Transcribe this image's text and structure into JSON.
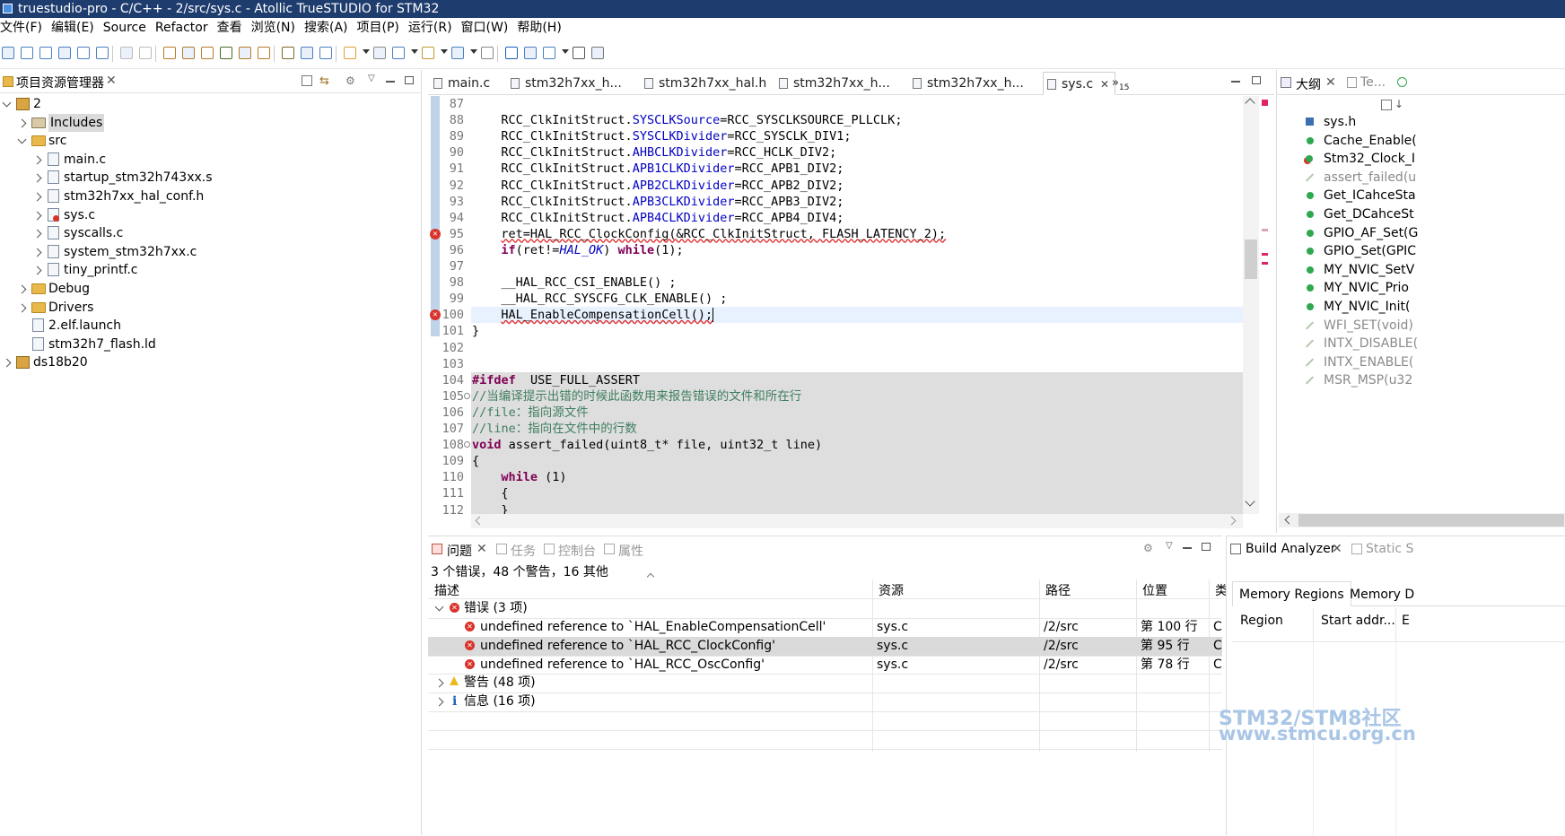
{
  "window": {
    "title": "truestudio-pro - C/C++ - 2/src/sys.c - Atollic TrueSTUDIO for STM32"
  },
  "menu": [
    "文件(F)",
    "编辑(E)",
    "Source",
    "Refactor",
    "查看",
    "浏览(N)",
    "搜索(A)",
    "项目(P)",
    "运行(R)",
    "窗口(W)",
    "帮助(H)"
  ],
  "explorer": {
    "title": "项目资源管理器",
    "tree": [
      {
        "label": "2",
        "depth": 0,
        "icon": "project-icon",
        "expanded": true
      },
      {
        "label": "Includes",
        "depth": 1,
        "icon": "includes-icon",
        "expanded": false,
        "selected": true
      },
      {
        "label": "src",
        "depth": 1,
        "icon": "source-folder-icon",
        "expanded": true
      },
      {
        "label": "main.c",
        "depth": 2,
        "icon": "c-file-icon",
        "expanded": false
      },
      {
        "label": "startup_stm32h743xx.s",
        "depth": 2,
        "icon": "asm-file-icon",
        "expanded": false
      },
      {
        "label": "stm32h7xx_hal_conf.h",
        "depth": 2,
        "icon": "h-file-icon",
        "expanded": false
      },
      {
        "label": "sys.c",
        "depth": 2,
        "icon": "c-file-error-icon",
        "expanded": false
      },
      {
        "label": "syscalls.c",
        "depth": 2,
        "icon": "c-file-icon",
        "expanded": false
      },
      {
        "label": "system_stm32h7xx.c",
        "depth": 2,
        "icon": "c-file-icon",
        "expanded": false
      },
      {
        "label": "tiny_printf.c",
        "depth": 2,
        "icon": "c-file-icon",
        "expanded": false
      },
      {
        "label": "Debug",
        "depth": 1,
        "icon": "folder-icon",
        "expanded": false
      },
      {
        "label": "Drivers",
        "depth": 1,
        "icon": "folder-icon",
        "expanded": false
      },
      {
        "label": "2.elf.launch",
        "depth": 1,
        "icon": "launch-file-icon",
        "leaf": true
      },
      {
        "label": "stm32h7_flash.ld",
        "depth": 1,
        "icon": "ld-file-icon",
        "leaf": true
      },
      {
        "label": "ds18b20",
        "depth": 0,
        "icon": "project-icon",
        "expanded": false
      }
    ]
  },
  "editor": {
    "tabs": [
      {
        "label": "main.c",
        "active": false
      },
      {
        "label": "stm32h7xx_h...",
        "active": false
      },
      {
        "label": "stm32h7xx_hal.h",
        "active": false
      },
      {
        "label": "stm32h7xx_h...",
        "active": false
      },
      {
        "label": "stm32h7xx_h...",
        "active": false
      },
      {
        "label": "sys.c",
        "active": true
      }
    ],
    "overflow_label": "»",
    "overflow_count": "15",
    "lines": [
      {
        "n": "87",
        "t": ""
      },
      {
        "n": "88",
        "t": "RCC_ClkInitStruct.SYSCLKSource=RCC_SYSCLKSOURCE_PLLCLK;"
      },
      {
        "n": "89",
        "t": "RCC_ClkInitStruct.SYSCLKDivider=RCC_SYSCLK_DIV1;"
      },
      {
        "n": "90",
        "t": "RCC_ClkInitStruct.AHBCLKDivider=RCC_HCLK_DIV2;"
      },
      {
        "n": "91",
        "t": "RCC_ClkInitStruct.APB1CLKDivider=RCC_APB1_DIV2;"
      },
      {
        "n": "92",
        "t": "RCC_ClkInitStruct.APB2CLKDivider=RCC_APB2_DIV2;"
      },
      {
        "n": "93",
        "t": "RCC_ClkInitStruct.APB3CLKDivider=RCC_APB3_DIV2;"
      },
      {
        "n": "94",
        "t": "RCC_ClkInitStruct.APB4CLKDivider=RCC_APB4_DIV4;"
      },
      {
        "n": "95",
        "t": "ret=HAL_RCC_ClockConfig(&RCC_ClkInitStruct, FLASH_LATENCY_2);"
      },
      {
        "n": "96",
        "t": "if(ret!=HAL_OK) while(1);"
      },
      {
        "n": "97",
        "t": ""
      },
      {
        "n": "98",
        "t": "__HAL_RCC_CSI_ENABLE() ;"
      },
      {
        "n": "99",
        "t": "__HAL_RCC_SYSCFG_CLK_ENABLE() ;"
      },
      {
        "n": "100",
        "t": "HAL_EnableCompensationCell();"
      },
      {
        "n": "101",
        "t": "}"
      },
      {
        "n": "102",
        "t": ""
      },
      {
        "n": "103",
        "t": ""
      },
      {
        "n": "104",
        "t": "#ifdef  USE_FULL_ASSERT"
      },
      {
        "n": "105",
        "t": "//当编译提示出错的时候此函数用来报告错误的文件和所在行"
      },
      {
        "n": "106",
        "t": "//file：指向源文件"
      },
      {
        "n": "107",
        "t": "//line：指向在文件中的行数"
      },
      {
        "n": "108",
        "t": "void assert_failed(uint8_t* file, uint32_t line)"
      },
      {
        "n": "109",
        "t": "{"
      },
      {
        "n": "110",
        "t": "while (1)"
      },
      {
        "n": "111",
        "t": "{"
      },
      {
        "n": "112",
        "t": "}"
      }
    ]
  },
  "outline": {
    "tab": "大纲",
    "tab2": "Te...",
    "items": [
      "sys.h",
      "Cache_Enable(",
      "Stm32_Clock_I",
      "assert_failed(u",
      "Get_ICahceSta",
      "Get_DCahceSt",
      "GPIO_AF_Set(G",
      "GPIO_Set(GPIC",
      "MY_NVIC_SetV",
      "MY_NVIC_Prio",
      "MY_NVIC_Init(",
      "WFI_SET(void)",
      "INTX_DISABLE(",
      "INTX_ENABLE(",
      "MSR_MSP(u32"
    ]
  },
  "problems": {
    "tabs": [
      "问题",
      "任务",
      "控制台",
      "属性"
    ],
    "summary": "3 个错误，48 个警告，16 其他",
    "columns": [
      "描述",
      "资源",
      "路径",
      "位置",
      "类"
    ],
    "groups": {
      "errors": "错误 (3 项)",
      "warnings": "警告 (48 项)",
      "infos": "信息 (16 项)"
    },
    "rows": [
      {
        "desc": "undefined reference to `HAL_EnableCompensationCell'",
        "res": "sys.c",
        "path": "/2/src",
        "loc": "第 100 行",
        "type": "C"
      },
      {
        "desc": "undefined reference to `HAL_RCC_ClockConfig'",
        "res": "sys.c",
        "path": "/2/src",
        "loc": "第 95 行",
        "type": "C"
      },
      {
        "desc": "undefined reference to `HAL_RCC_OscConfig'",
        "res": "sys.c",
        "path": "/2/src",
        "loc": "第 78 行",
        "type": "C"
      }
    ]
  },
  "build_analyzer": {
    "tab": "Build Analyzer",
    "tab2": "Static S",
    "subtabs": [
      "Memory Regions",
      "Memory D"
    ],
    "columns": [
      "Region",
      "Start addr...",
      "E"
    ]
  },
  "watermark": {
    "line1": "STM32/STM8社区",
    "line2": "www.stmcu.org.cn"
  }
}
